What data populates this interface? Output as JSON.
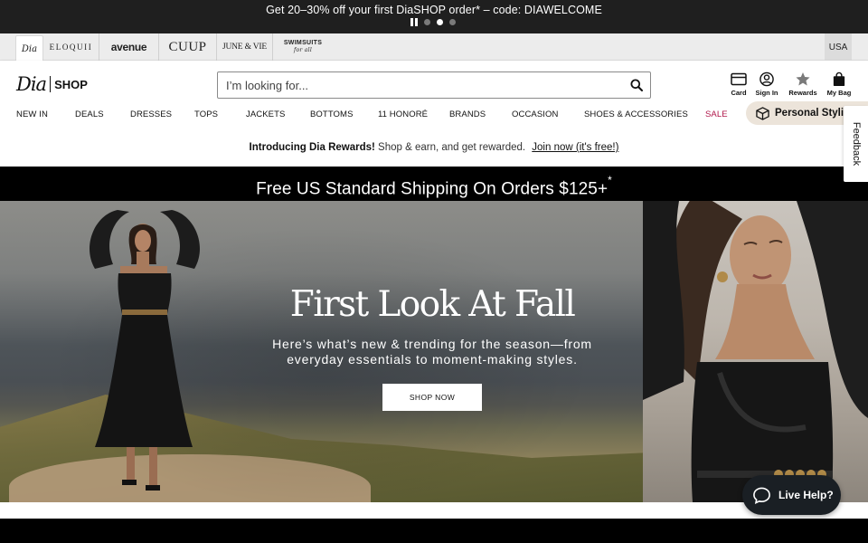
{
  "promo": {
    "text": "Get 20–30% off your first DiaSHOP order* – code: DIAWELCOME",
    "slides": 3,
    "active_slide": 2
  },
  "brands": {
    "items": [
      {
        "label": "Dia",
        "active": true
      },
      {
        "label": "ELOQUII"
      },
      {
        "label": "avenue"
      },
      {
        "label": "CUUP"
      },
      {
        "label": "JUNE & VIE"
      },
      {
        "label": "SWIMSUITS",
        "sub": "for all"
      }
    ],
    "country": "USA"
  },
  "header": {
    "logo_main": "Dia",
    "logo_shop": "SHOP",
    "search_placeholder": "I’m looking for...",
    "utilities": [
      {
        "label": "Card",
        "icon": "credit-card-icon"
      },
      {
        "label": "Sign In",
        "icon": "user-icon"
      },
      {
        "label": "Rewards",
        "icon": "star-icon"
      },
      {
        "label": "My Bag",
        "icon": "bag-icon"
      }
    ],
    "nav": [
      "NEW IN",
      "DEALS",
      "DRESSES",
      "TOPS",
      "JACKETS",
      "BOTTOMS",
      "11 HONORÉ",
      "BRANDS",
      "OCCASION",
      "SHOES & ACCESSORIES",
      "SALE"
    ],
    "styling_label": "Personal Styling"
  },
  "rewards": {
    "title": "Introducing Dia Rewards!",
    "text": "Shop & earn, and get rewarded.",
    "link": "Join now (it's free!)"
  },
  "shipping": {
    "text": "Free US Standard Shipping On Orders $125+",
    "mark": "*"
  },
  "hero": {
    "title": "First Look At Fall",
    "subtitle_1": "Here’s what’s new & trending for the season—from",
    "subtitle_2": "everyday essentials to moment-making styles.",
    "button": "SHOP NOW"
  },
  "feedback": "Feedback",
  "live_help": "Live Help?",
  "colors": {
    "promo_bg": "#1f1f1f",
    "sale": "#b0174a",
    "styling_bg": "#ece4da",
    "live_help_bg": "#1a1f24"
  }
}
